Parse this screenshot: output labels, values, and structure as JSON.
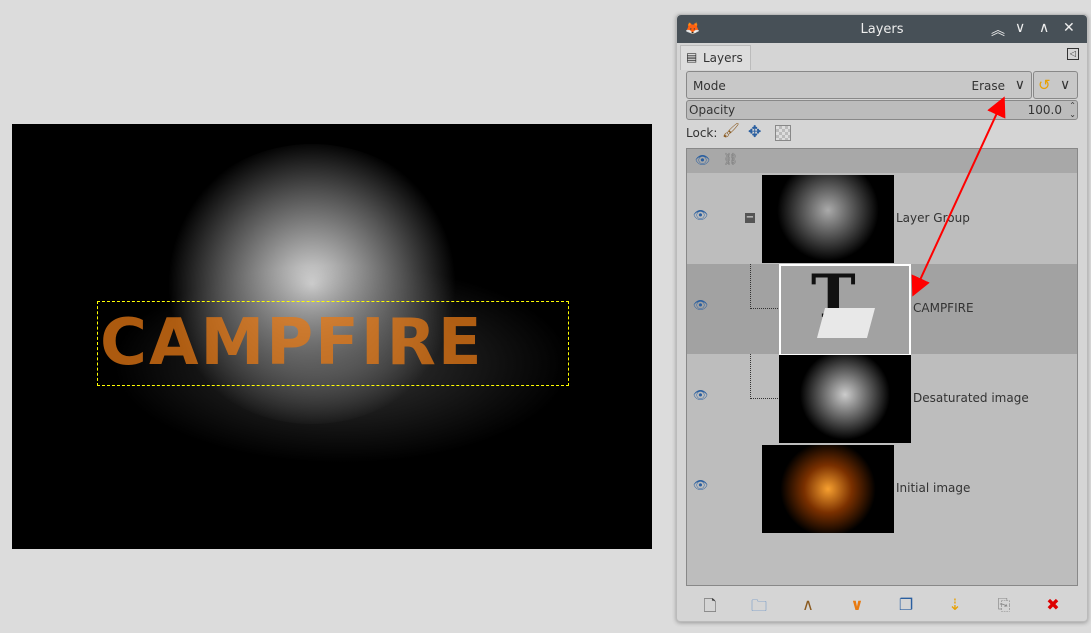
{
  "canvas": {
    "text_layer": "CAMPFIRE"
  },
  "dock": {
    "title": "Layers",
    "tab_label": "Layers",
    "mode_label": "Mode",
    "mode_value": "Erase",
    "opacity_label": "Opacity",
    "opacity_value": "100.0",
    "lock_label": "Lock:",
    "layers": [
      {
        "name": "Layer Group",
        "visible": true,
        "group": true
      },
      {
        "name": "CAMPFIRE",
        "visible": true,
        "selected": true
      },
      {
        "name": "Desaturated image",
        "visible": true
      },
      {
        "name": "Initial image",
        "visible": true
      }
    ],
    "toolbar": [
      "new-layer",
      "new-layer-group",
      "raise-layer",
      "lower-layer",
      "duplicate-layer",
      "merge-down",
      "anchor-layer",
      "delete-layer"
    ]
  },
  "annotation_color": "#ff0000"
}
